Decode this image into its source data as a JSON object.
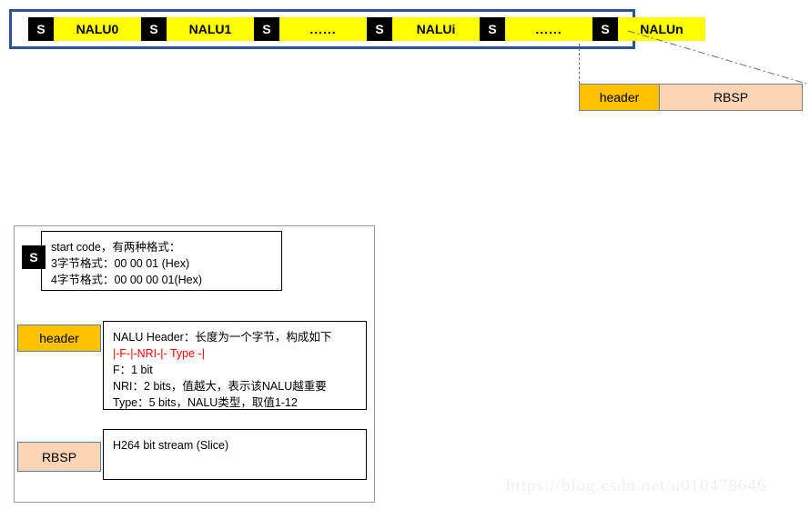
{
  "stream": {
    "segments": [
      {
        "type": "start-code",
        "label": "S"
      },
      {
        "type": "nalu",
        "label": "NALU0"
      },
      {
        "type": "start-code",
        "label": "S"
      },
      {
        "type": "nalu",
        "label": "NALU1"
      },
      {
        "type": "start-code",
        "label": "S"
      },
      {
        "type": "ellipsis",
        "label": "......"
      },
      {
        "type": "start-code",
        "label": "S"
      },
      {
        "type": "nalu",
        "label": "NALUi"
      },
      {
        "type": "start-code",
        "label": "S"
      },
      {
        "type": "ellipsis",
        "label": "......"
      },
      {
        "type": "start-code",
        "label": "S"
      },
      {
        "type": "nalu",
        "label": "NALUn"
      }
    ]
  },
  "nalu_detail": {
    "header_label": "header",
    "rbsp_label": "RBSP"
  },
  "legend": {
    "start_code": {
      "swatch_label": "S",
      "lines": [
        "start code，有两种格式：",
        "3字节格式：00 00 01 (Hex)",
        "4字节格式：00 00 00 01(Hex)"
      ]
    },
    "header": {
      "swatch_label": "header",
      "lines": [
        "NALU Header：长度为一个字节，构成如下",
        "|-F-|-NRI-|- Type -|",
        "F：1 bit",
        "NRI：2 bits，值越大，表示该NALU越重要",
        "Type：5 bits，NALU类型，取值1-12"
      ],
      "red_line_index": 1
    },
    "rbsp": {
      "swatch_label": "RBSP",
      "lines": [
        "H264 bit stream (Slice)"
      ]
    }
  },
  "watermark": {
    "text": "https://blog.csdn.net/u010478646"
  },
  "colors": {
    "stream_border": "#2e5395",
    "start_code_bg": "#000000",
    "nalu_bg": "#ffff00",
    "header_bg": "#ffc000",
    "rbsp_bg": "#fbd5b5",
    "callout_border": "#000000",
    "accent_red": "#ff0000",
    "panel_border": "#9b9b9b"
  }
}
